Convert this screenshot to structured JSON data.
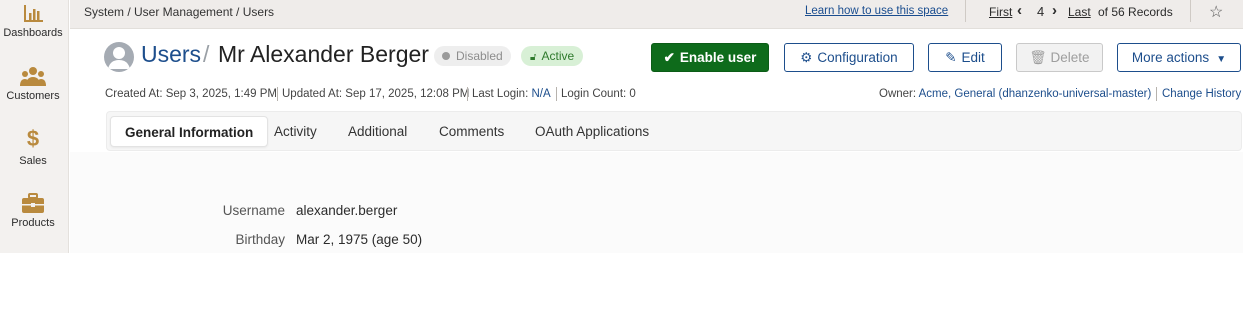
{
  "sidebar": {
    "items": [
      {
        "label": "Dashboards",
        "icon": "bar-chart-icon"
      },
      {
        "label": "Customers",
        "icon": "users-icon"
      },
      {
        "label": "Sales",
        "icon": "dollar-icon"
      },
      {
        "label": "Products",
        "icon": "briefcase-icon"
      }
    ]
  },
  "topbar": {
    "breadcrumb": "System / User Management / Users",
    "learn_link": "Learn how to use this space",
    "pager": {
      "first": "First",
      "current": "4",
      "last": "Last",
      "total": "of 56 Records"
    }
  },
  "header": {
    "section": "Users",
    "slash": "/",
    "name": "Mr Alexander Berger",
    "badge_disabled": "Disabled",
    "badge_active": "Active"
  },
  "actions": {
    "enable": "Enable user",
    "configuration": "Configuration",
    "edit": "Edit",
    "delete": "Delete",
    "more": "More actions"
  },
  "meta": {
    "created": "Created At: Sep 3, 2025, 1:49 PM",
    "updated": "Updated At: Sep 17, 2025, 12:08 PM",
    "last_login_label": "Last Login:",
    "last_login_value": "N/A",
    "login_count": "Login Count: 0",
    "owner_label": "Owner:",
    "owner_value": "Acme, General (dhanzenko-universal-master)",
    "change_history": "Change History"
  },
  "tabs": [
    {
      "label": "General Information",
      "active": true
    },
    {
      "label": "Activity",
      "active": false
    },
    {
      "label": "Additional",
      "active": false
    },
    {
      "label": "Comments",
      "active": false
    },
    {
      "label": "OAuth Applications",
      "active": false
    }
  ],
  "fields": [
    {
      "label": "Username",
      "value": "alexander.berger"
    },
    {
      "label": "Birthday",
      "value": "Mar 2, 1975 (age 50)"
    }
  ],
  "colors": {
    "brand_blue": "#1d4e8c",
    "primary_green": "#0e6b1b",
    "sidebar_icon_gold": "#b98a3e",
    "active_badge_bg": "#d8f0d6"
  }
}
